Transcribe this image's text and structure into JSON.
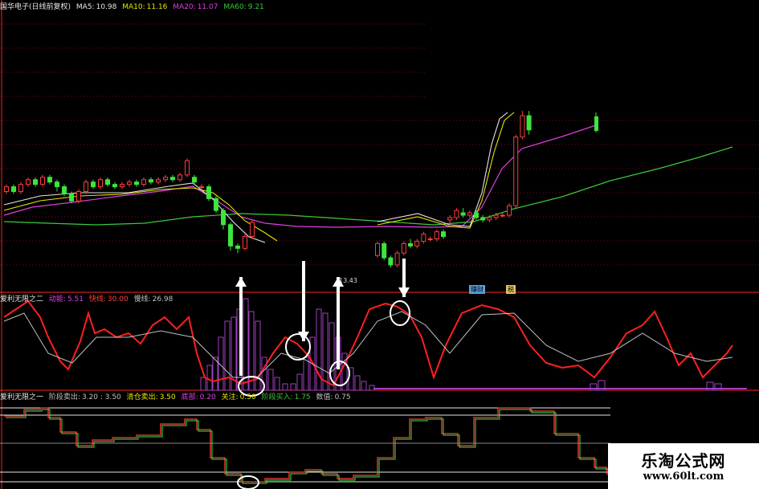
{
  "main_header": {
    "name": "国华电子(日线前复权)",
    "ma5_label": "MA5:",
    "ma5_value": "10.98",
    "ma10_label": "MA10:",
    "ma10_value": "11.16",
    "ma20_label": "MA20:",
    "ma20_value": "11.07",
    "ma60_label": "MA60:",
    "ma60_value": "9.21"
  },
  "ind2_header": {
    "name": "爱利无限之二",
    "k1_label": "动能:",
    "k1_value": "5.51",
    "k2_label": "快线:",
    "k2_value": "30.00",
    "k3_label": "慢线:",
    "k3_value": "26.98"
  },
  "ind1_header": {
    "name": "爱利无限之一",
    "k1_label": "阶段卖出:",
    "k1_value": "3.20 : 3.50",
    "k2_label": "清仓卖出:",
    "k2_value": "3.50",
    "k3_label": "底部:",
    "k3_value": "0.20",
    "k4_label": "关注:",
    "k4_value": "0.50",
    "k5_label": "阶段买入:",
    "k5_value": "1.75",
    "k6_label": "数值:",
    "k6_value": "0.75"
  },
  "price_note": "13.43",
  "tag_a": "赚财",
  "tag_b": "税",
  "watermark": {
    "title": "乐淘公式网",
    "url": "www.60lt.com"
  },
  "chart_data": {
    "type": "candlestick-with-indicators",
    "panels": [
      "price",
      "indicator-2",
      "indicator-1"
    ],
    "ma_periods": [
      5,
      10,
      20,
      60
    ],
    "colors": {
      "background": "#000000",
      "up": "#ff3c3c",
      "down": "#3ce63c",
      "ma5": "#e6e6e6",
      "ma10": "#e6e600",
      "ma20": "#e040e0",
      "ma60": "#3cc83c",
      "fast_line": "#ff2020",
      "slow_line": "#c0c0c0",
      "histogram": "#a040c0",
      "step_line": "#ff3c3c",
      "grid": "#ff2020"
    },
    "price_candles": [
      {
        "open": 11.0,
        "close": 11.2,
        "high": 11.3,
        "low": 10.9
      },
      {
        "open": 11.2,
        "close": 11.0,
        "high": 11.3,
        "low": 10.9
      },
      {
        "open": 11.0,
        "close": 11.3,
        "high": 11.4,
        "low": 10.9
      },
      {
        "open": 11.3,
        "close": 11.5,
        "high": 11.6,
        "low": 11.2
      },
      {
        "open": 11.5,
        "close": 11.3,
        "high": 11.6,
        "low": 11.2
      },
      {
        "open": 11.3,
        "close": 11.6,
        "high": 11.7,
        "low": 11.2
      },
      {
        "open": 11.6,
        "close": 11.4,
        "high": 11.7,
        "low": 11.3
      },
      {
        "open": 11.4,
        "close": 11.2,
        "high": 11.5,
        "low": 11.0
      },
      {
        "open": 11.2,
        "close": 10.9,
        "high": 11.3,
        "low": 10.8
      },
      {
        "open": 10.9,
        "close": 10.6,
        "high": 11.0,
        "low": 10.5
      },
      {
        "open": 10.6,
        "close": 11.0,
        "high": 11.1,
        "low": 10.5
      },
      {
        "open": 11.0,
        "close": 11.4,
        "high": 11.5,
        "low": 10.9
      },
      {
        "open": 11.4,
        "close": 11.2,
        "high": 11.5,
        "low": 11.1
      },
      {
        "open": 11.2,
        "close": 11.5,
        "high": 11.6,
        "low": 11.1
      },
      {
        "open": 11.5,
        "close": 11.3,
        "high": 11.6,
        "low": 11.2
      },
      {
        "open": 11.3,
        "close": 11.2,
        "high": 11.4,
        "low": 11.1
      },
      {
        "open": 11.2,
        "close": 11.3,
        "high": 11.4,
        "low": 11.1
      },
      {
        "open": 11.3,
        "close": 11.4,
        "high": 11.5,
        "low": 11.2
      },
      {
        "open": 11.4,
        "close": 11.3,
        "high": 11.5,
        "low": 11.2
      },
      {
        "open": 11.3,
        "close": 11.5,
        "high": 11.6,
        "low": 11.2
      },
      {
        "open": 11.5,
        "close": 11.4,
        "high": 11.6,
        "low": 11.3
      },
      {
        "open": 11.4,
        "close": 11.5,
        "high": 11.6,
        "low": 11.3
      },
      {
        "open": 11.5,
        "close": 11.6,
        "high": 11.7,
        "low": 11.4
      },
      {
        "open": 11.6,
        "close": 11.5,
        "high": 11.7,
        "low": 11.4
      },
      {
        "open": 11.5,
        "close": 11.7,
        "high": 11.8,
        "low": 11.4
      },
      {
        "open": 11.7,
        "close": 12.3,
        "high": 12.4,
        "low": 11.6
      },
      {
        "open": 11.6,
        "close": 11.4,
        "high": 11.7,
        "low": 11.3
      },
      {
        "open": 11.2,
        "close": 11.2,
        "high": 11.3,
        "low": 11.1
      },
      {
        "open": 11.2,
        "close": 10.7,
        "high": 11.3,
        "low": 10.6
      },
      {
        "open": 10.7,
        "close": 10.2,
        "high": 10.8,
        "low": 10.1
      },
      {
        "open": 10.2,
        "close": 9.6,
        "high": 10.3,
        "low": 9.4
      },
      {
        "open": 9.6,
        "close": 8.7,
        "high": 9.7,
        "low": 8.5
      },
      {
        "open": 8.7,
        "close": 8.6,
        "high": 8.8,
        "low": 8.4
      },
      {
        "open": 8.6,
        "close": 9.1,
        "high": 9.2,
        "low": 8.5
      },
      {
        "open": 9.1,
        "close": 9.7,
        "high": 9.8,
        "low": 9.0
      }
    ],
    "price_candles_late": [
      {
        "open": 8.3,
        "close": 8.8,
        "high": 8.9,
        "low": 8.2
      },
      {
        "open": 8.8,
        "close": 8.2,
        "high": 8.9,
        "low": 8.1
      },
      {
        "open": 8.2,
        "close": 7.9,
        "high": 8.3,
        "low": 7.8
      },
      {
        "open": 7.9,
        "close": 8.4,
        "high": 8.5,
        "low": 7.8
      },
      {
        "open": 8.4,
        "close": 8.8,
        "high": 8.9,
        "low": 8.3
      },
      {
        "open": 8.8,
        "close": 8.7,
        "high": 9.0,
        "low": 8.6
      },
      {
        "open": 8.7,
        "close": 8.9,
        "high": 9.0,
        "low": 8.6
      },
      {
        "open": 8.9,
        "close": 9.2,
        "high": 9.3,
        "low": 8.8
      },
      {
        "open": 9.0,
        "close": 9.0,
        "high": 9.1,
        "low": 8.9
      },
      {
        "open": 9.0,
        "close": 9.3,
        "high": 9.4,
        "low": 8.9
      },
      {
        "open": 9.3,
        "close": 9.1,
        "high": 9.4,
        "low": 9.0
      },
      {
        "open": 9.8,
        "close": 9.9,
        "high": 10.0,
        "low": 9.6
      },
      {
        "open": 9.9,
        "close": 10.2,
        "high": 10.3,
        "low": 9.8
      },
      {
        "open": 10.1,
        "close": 10.0,
        "high": 10.3,
        "low": 9.9
      },
      {
        "open": 10.0,
        "close": 10.1,
        "high": 10.2,
        "low": 9.9
      },
      {
        "open": 10.1,
        "close": 9.9,
        "high": 10.2,
        "low": 9.8
      },
      {
        "open": 9.9,
        "close": 9.8,
        "high": 10.0,
        "low": 9.7
      },
      {
        "open": 9.8,
        "close": 9.9,
        "high": 10.0,
        "low": 9.7
      },
      {
        "open": 9.9,
        "close": 10.0,
        "high": 10.1,
        "low": 9.8
      },
      {
        "open": 10.0,
        "close": 10.0,
        "high": 10.1,
        "low": 9.9
      },
      {
        "open": 10.0,
        "close": 10.4,
        "high": 10.5,
        "low": 9.9
      },
      {
        "open": 10.4,
        "close": 13.3,
        "high": 13.4,
        "low": 10.3
      },
      {
        "open": 13.3,
        "close": 14.2,
        "high": 14.4,
        "low": 13.2
      },
      {
        "open": 14.2,
        "close": 13.6,
        "high": 14.4,
        "low": 13.4
      }
    ]
  }
}
